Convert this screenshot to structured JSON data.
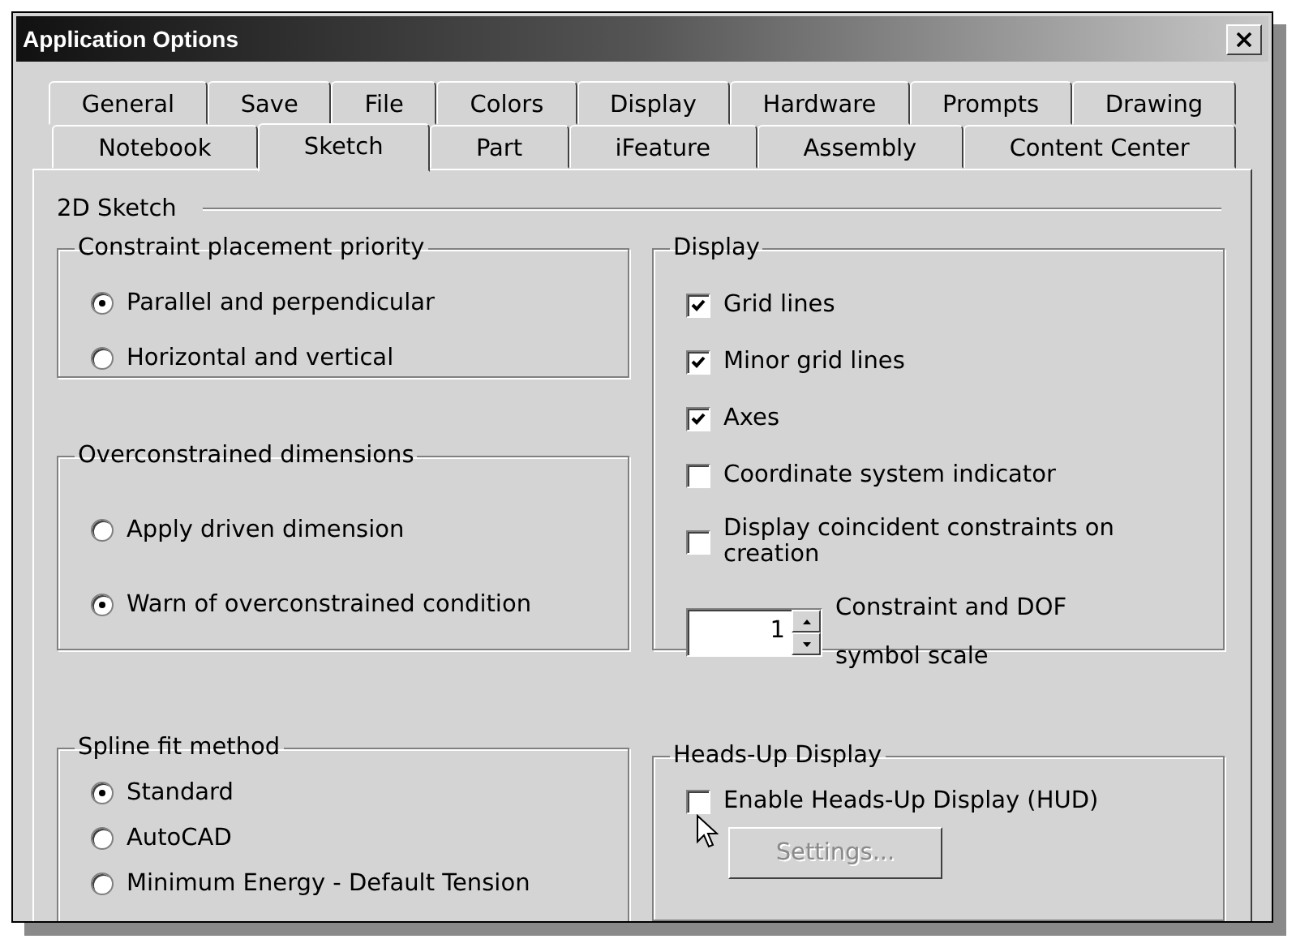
{
  "window": {
    "title": "Application Options"
  },
  "tab_rows": [
    [
      {
        "label": "General",
        "selected": false
      },
      {
        "label": "Save",
        "selected": false
      },
      {
        "label": "File",
        "selected": false
      },
      {
        "label": "Colors",
        "selected": false
      },
      {
        "label": "Display",
        "selected": false
      },
      {
        "label": "Hardware",
        "selected": false
      },
      {
        "label": "Prompts",
        "selected": false
      },
      {
        "label": "Drawing",
        "selected": false
      }
    ],
    [
      {
        "label": "Notebook",
        "selected": false
      },
      {
        "label": "Sketch",
        "selected": true
      },
      {
        "label": "Part",
        "selected": false
      },
      {
        "label": "iFeature",
        "selected": false
      },
      {
        "label": "Assembly",
        "selected": false
      },
      {
        "label": "Content Center",
        "selected": false
      }
    ]
  ],
  "section": {
    "title": "2D Sketch"
  },
  "left_groups": [
    {
      "title": "Constraint placement priority",
      "items": [
        {
          "kind": "radio",
          "label": "Parallel and perpendicular",
          "selected": true
        },
        {
          "kind": "radio",
          "label": "Horizontal and vertical",
          "selected": false
        }
      ]
    },
    {
      "title": "Overconstrained dimensions",
      "items": [
        {
          "kind": "radio",
          "label": "Apply driven dimension",
          "selected": false
        },
        {
          "kind": "radio",
          "label": "Warn of overconstrained condition",
          "selected": true
        }
      ]
    },
    {
      "title": "Spline fit method",
      "items": [
        {
          "kind": "radio",
          "label": "Standard",
          "selected": true
        },
        {
          "kind": "radio",
          "label": "AutoCAD",
          "selected": false
        },
        {
          "kind": "radio",
          "label": "Minimum Energy - Default Tension",
          "selected": false
        }
      ]
    }
  ],
  "right_groups": [
    {
      "title": "Display",
      "items": [
        {
          "kind": "checkbox",
          "label": "Grid lines",
          "checked": true
        },
        {
          "kind": "checkbox",
          "label": "Minor grid lines",
          "checked": true
        },
        {
          "kind": "checkbox",
          "label": "Axes",
          "checked": true
        },
        {
          "kind": "checkbox",
          "label": "Coordinate system indicator",
          "checked": false
        },
        {
          "kind": "checkbox",
          "label": "Display coincident constraints on creation",
          "checked": false
        },
        {
          "kind": "spin",
          "value": "1",
          "label": "Constraint and DOF symbol scale"
        }
      ]
    },
    {
      "title": "Heads-Up Display",
      "items": [
        {
          "kind": "checkbox",
          "label": "Enable Heads-Up Display (HUD)",
          "checked": false
        },
        {
          "kind": "button",
          "label": "Settings...",
          "disabled": true
        }
      ]
    }
  ]
}
